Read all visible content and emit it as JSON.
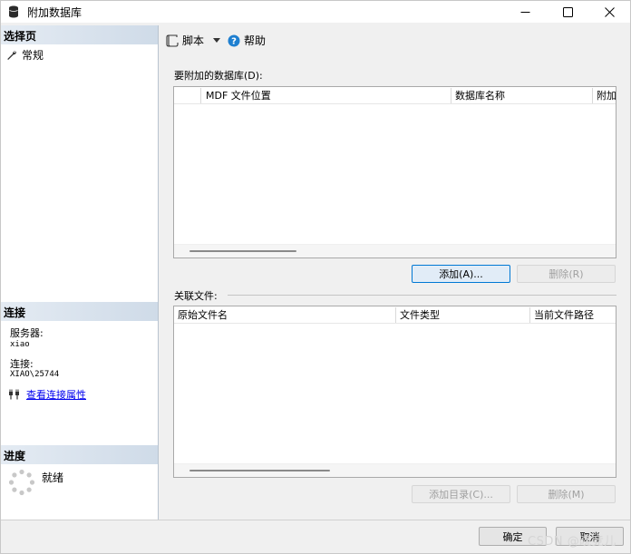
{
  "window": {
    "title": "附加数据库",
    "min_glyph": "—",
    "max_glyph": "☐",
    "close_glyph": "✕"
  },
  "left": {
    "select_page_header": "选择页",
    "nav_items": [
      {
        "label": "常规",
        "icon": "wrench-icon"
      }
    ],
    "connection_header": "连接",
    "server_label": "服务器:",
    "server_value": "xiao",
    "connection_label": "连接:",
    "connection_value": "XIAO\\25744",
    "view_props_link": "查看连接属性",
    "progress_header": "进度",
    "progress_status": "就绪"
  },
  "toolbar": {
    "script_label": "脚本",
    "help_label": "帮助"
  },
  "attach": {
    "group_label": "要附加的数据库(D):",
    "columns": [
      "MDF 文件位置",
      "数据库名称",
      "附加"
    ],
    "add_button": "添加(A)...",
    "remove_button": "删除(R)"
  },
  "files": {
    "group_label": "关联文件:",
    "columns": [
      "原始文件名",
      "文件类型",
      "当前文件路径"
    ],
    "add_catalog_button": "添加目录(C)...",
    "remove_button": "删除(M)"
  },
  "footer": {
    "ok_button": "确定",
    "cancel_button": "取消",
    "watermark": "CSDN @晓竞儿"
  },
  "colors": {
    "accent": "#0078d4",
    "link": "#0000ee",
    "section_header": "#d9e3ee"
  }
}
